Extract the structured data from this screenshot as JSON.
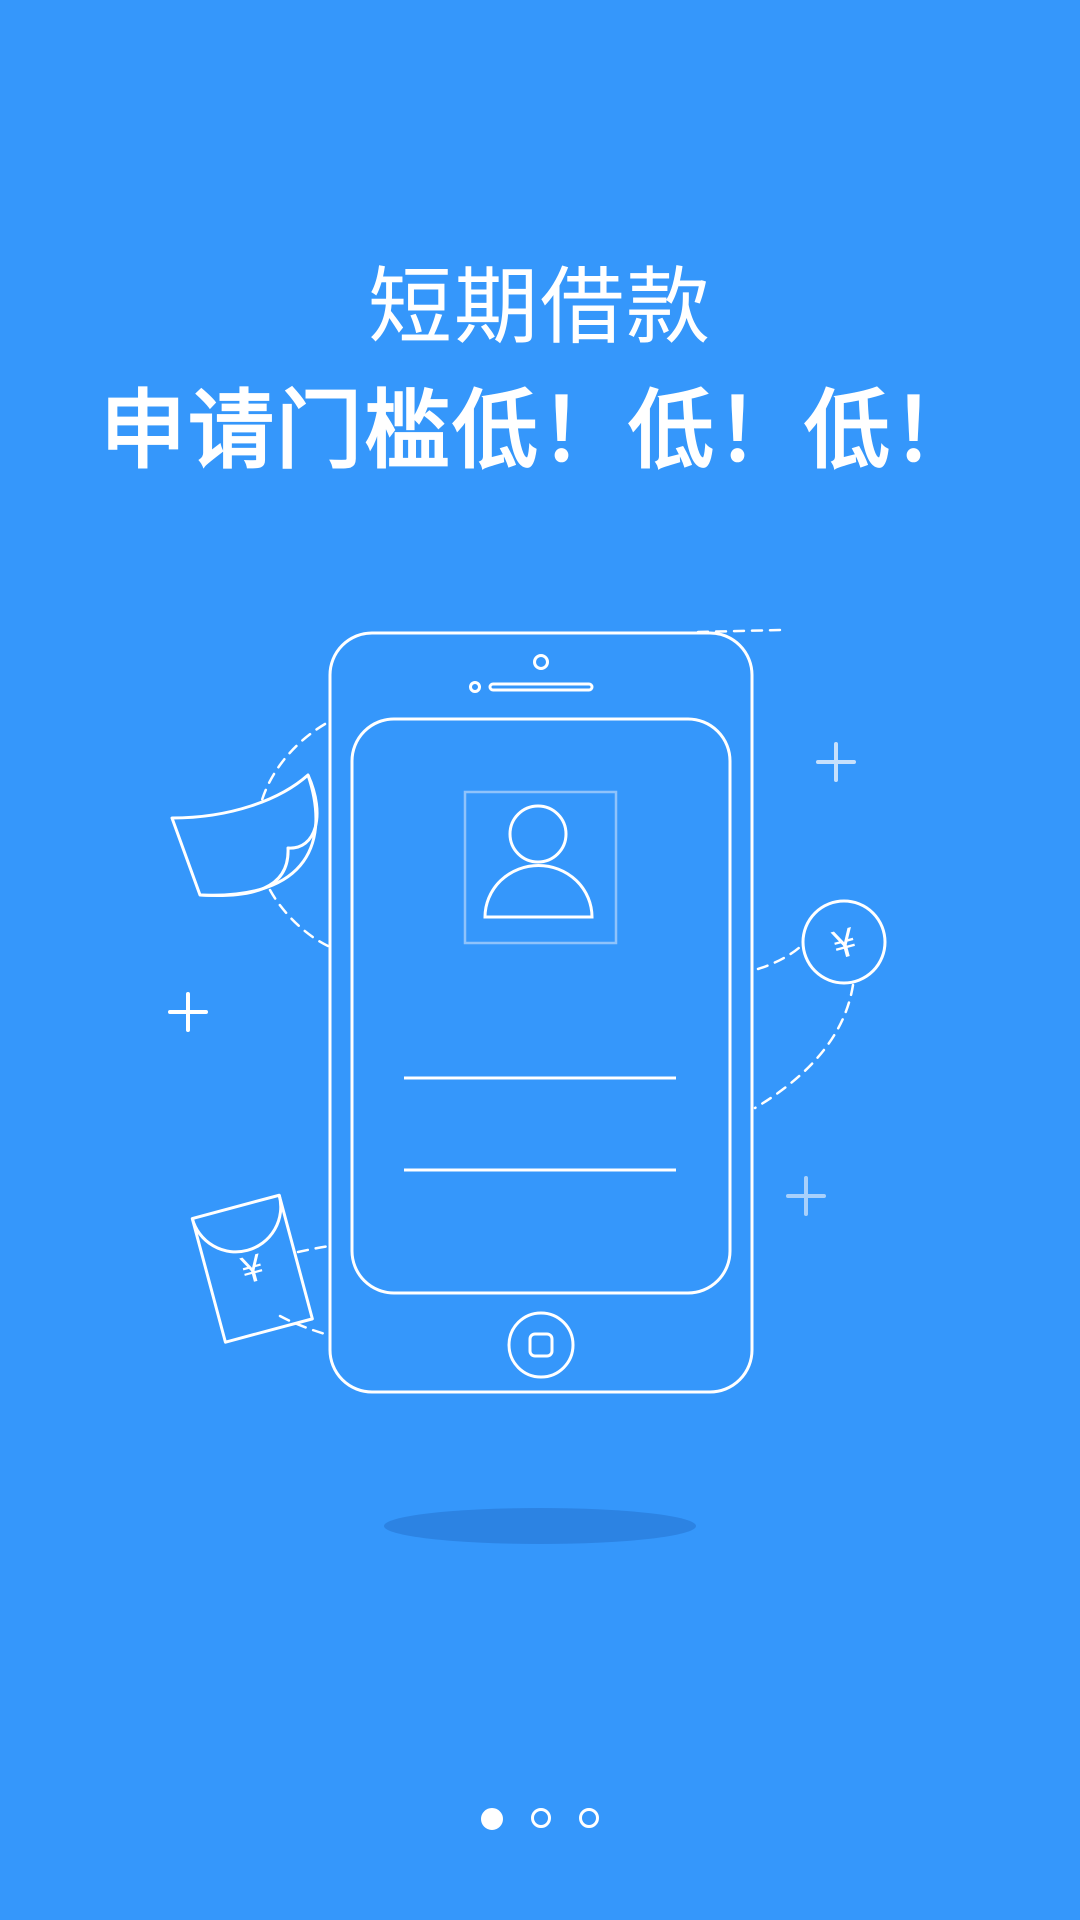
{
  "onboarding": {
    "subtitle": "短期借款",
    "headline": "申请门槛低！低！低！",
    "currency_symbol": "¥",
    "page_indicator": {
      "total": 3,
      "current": 1
    }
  },
  "colors": {
    "background": "#3597fb",
    "line": "#ffffff",
    "shadow": "#2a7fde",
    "muted_plus": "#a8d0fb"
  },
  "icons": {
    "phone": "smartphone-outline-icon",
    "avatar": "user-avatar-icon",
    "bill": "banknote-icon",
    "coin": "yuan-coin-icon",
    "envelope": "red-envelope-icon",
    "plus": "plus-sparkle-icon"
  }
}
